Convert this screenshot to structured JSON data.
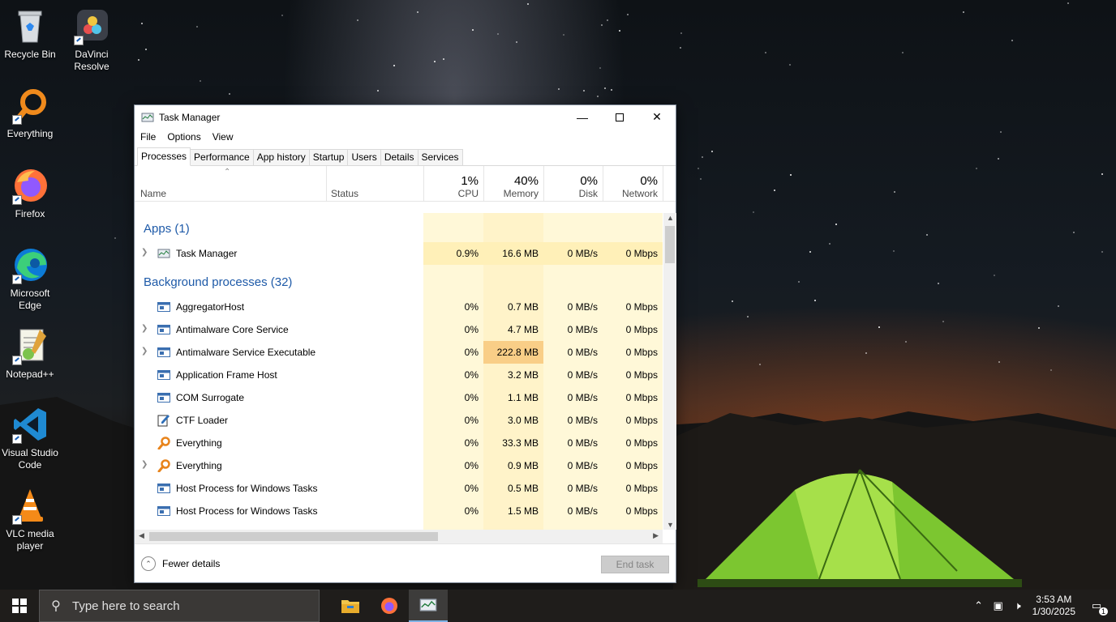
{
  "desktop": {
    "icons": [
      {
        "label": "Recycle Bin"
      },
      {
        "label": "DaVinci Resolve"
      },
      {
        "label": "Everything"
      },
      {
        "label": "Firefox"
      },
      {
        "label": "Microsoft Edge"
      },
      {
        "label": "Notepad++"
      },
      {
        "label": "Visual Studio Code"
      },
      {
        "label": "VLC media player"
      }
    ]
  },
  "window": {
    "title": "Task Manager",
    "menu": [
      "File",
      "Options",
      "View"
    ],
    "tabs": [
      "Processes",
      "Performance",
      "App history",
      "Startup",
      "Users",
      "Details",
      "Services"
    ],
    "active_tab": "Processes",
    "columns": {
      "name": "Name",
      "status": "Status",
      "cpu": {
        "label": "CPU",
        "pct": "1%"
      },
      "memory": {
        "label": "Memory",
        "pct": "40%"
      },
      "disk": {
        "label": "Disk",
        "pct": "0%"
      },
      "network": {
        "label": "Network",
        "pct": "0%"
      }
    },
    "groups": {
      "apps": "Apps (1)",
      "background": "Background processes (32)"
    },
    "apps": [
      {
        "name": "Task Manager",
        "cpu": "0.9%",
        "memory": "16.6 MB",
        "disk": "0 MB/s",
        "network": "0 Mbps",
        "expandable": true
      }
    ],
    "background": [
      {
        "name": "AggregatorHost",
        "cpu": "0%",
        "memory": "0.7 MB",
        "disk": "0 MB/s",
        "network": "0 Mbps",
        "expandable": false,
        "icon": "service-icon"
      },
      {
        "name": "Antimalware Core Service",
        "cpu": "0%",
        "memory": "4.7 MB",
        "disk": "0 MB/s",
        "network": "0 Mbps",
        "expandable": true,
        "icon": "service-icon"
      },
      {
        "name": "Antimalware Service Executable",
        "cpu": "0%",
        "memory": "222.8 MB",
        "disk": "0 MB/s",
        "network": "0 Mbps",
        "expandable": true,
        "icon": "service-icon",
        "highlight": true
      },
      {
        "name": "Application Frame Host",
        "cpu": "0%",
        "memory": "3.2 MB",
        "disk": "0 MB/s",
        "network": "0 Mbps",
        "expandable": false,
        "icon": "service-icon"
      },
      {
        "name": "COM Surrogate",
        "cpu": "0%",
        "memory": "1.1 MB",
        "disk": "0 MB/s",
        "network": "0 Mbps",
        "expandable": false,
        "icon": "service-icon"
      },
      {
        "name": "CTF Loader",
        "cpu": "0%",
        "memory": "3.0 MB",
        "disk": "0 MB/s",
        "network": "0 Mbps",
        "expandable": false,
        "icon": "ctf-icon"
      },
      {
        "name": "Everything",
        "cpu": "0%",
        "memory": "33.3 MB",
        "disk": "0 MB/s",
        "network": "0 Mbps",
        "expandable": false,
        "icon": "everything-icon"
      },
      {
        "name": "Everything",
        "cpu": "0%",
        "memory": "0.9 MB",
        "disk": "0 MB/s",
        "network": "0 Mbps",
        "expandable": true,
        "icon": "everything-icon"
      },
      {
        "name": "Host Process for Windows Tasks",
        "cpu": "0%",
        "memory": "0.5 MB",
        "disk": "0 MB/s",
        "network": "0 Mbps",
        "expandable": false,
        "icon": "service-icon"
      },
      {
        "name": "Host Process for Windows Tasks",
        "cpu": "0%",
        "memory": "1.5 MB",
        "disk": "0 MB/s",
        "network": "0 Mbps",
        "expandable": false,
        "icon": "service-icon"
      }
    ],
    "footer": {
      "fewer_details": "Fewer details",
      "end_task": "End task"
    }
  },
  "taskbar": {
    "search_placeholder": "Type here to search",
    "apps": [
      "file-explorer-icon",
      "firefox-icon",
      "task-manager-icon"
    ],
    "time": "3:53 AM",
    "date": "1/30/2025",
    "notification_count": "1"
  },
  "colors": {
    "heat_light": "#fff4c4",
    "heat_mid": "#ffe9a8",
    "heat_strong": "#f9ce87",
    "group_blue": "#1e5aa8"
  }
}
